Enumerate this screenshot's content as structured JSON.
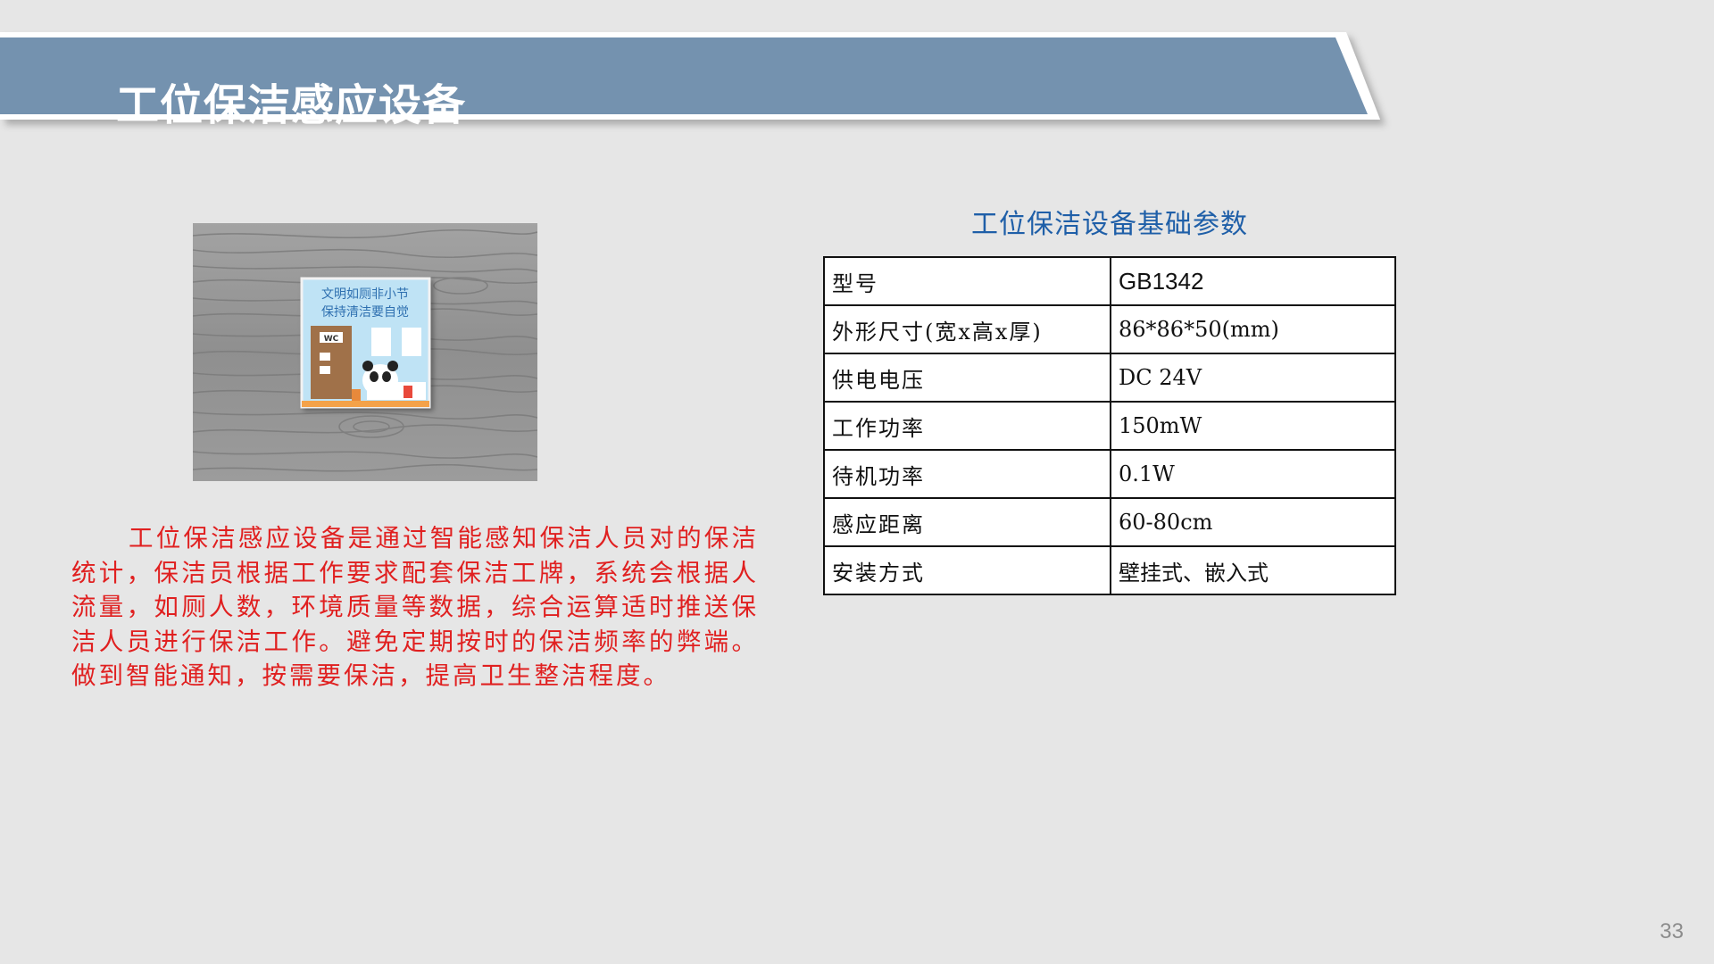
{
  "slide": {
    "title": "工位保洁感应设备",
    "page_number": "33"
  },
  "photo": {
    "sign_line1": "文明如厕非小节",
    "sign_line2": "保持清洁要自觉",
    "door_label": "WC",
    "colors": {
      "wood": "#9a9a9a",
      "sign_bg": "#bfe3f5",
      "sign_text": "#2f6fb0",
      "door": "#a0714a"
    }
  },
  "description": "工位保洁感应设备是通过智能感知保洁人员对的保洁统计，保洁员根据工作要求配套保洁工牌，系统会根据人流量，如厕人数，环境质量等数据，综合运算适时推送保洁人员进行保洁工作。避免定期按时的保洁频率的弊端。做到智能通知，按需要保洁，提高卫生整洁程度。",
  "params_table": {
    "caption": "工位保洁设备基础参数",
    "rows": [
      {
        "key": "型号",
        "value": "GB1342"
      },
      {
        "key": "外形尺寸(宽x高x厚)",
        "value": "86*86*50(mm)"
      },
      {
        "key": "供电电压",
        "value": "DC 24V"
      },
      {
        "key": "工作功率",
        "value": "150mW"
      },
      {
        "key": "待机功率",
        "value": "0.1W"
      },
      {
        "key": "感应距离",
        "value": "60-80cm"
      },
      {
        "key": "安装方式",
        "value": "壁挂式、嵌入式"
      }
    ]
  },
  "colors": {
    "background": "#e6e6e6",
    "banner": "#7492af",
    "description_text": "#e02020",
    "caption_text": "#1f5fa8"
  }
}
